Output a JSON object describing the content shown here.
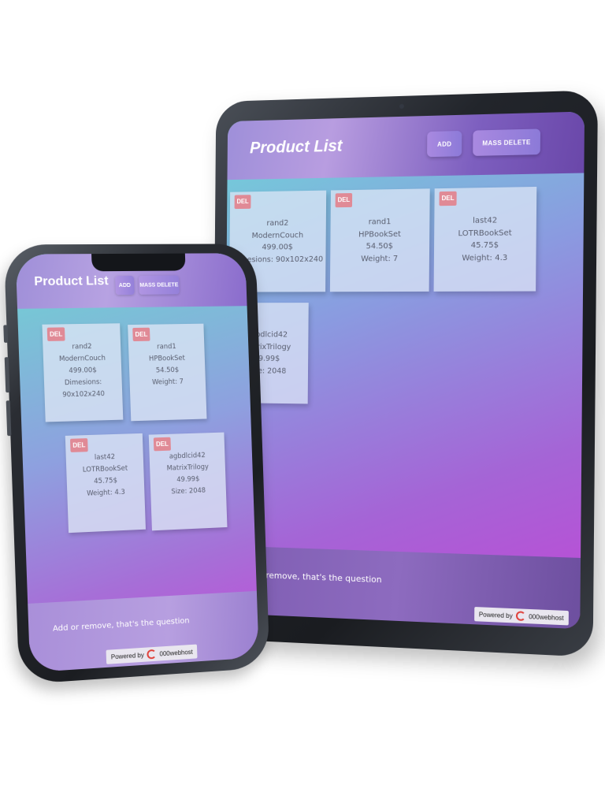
{
  "app": {
    "title": "Product List",
    "add_label": "ADD",
    "mass_delete_label": "MASS DELETE",
    "delete_label": "DEL",
    "footer_text": "Add or remove, that's the question",
    "powered_by": "Powered by",
    "host_name": "000webhost",
    "colors": {
      "delete_badge": "#e08a96",
      "header": "#9e8fd9",
      "gradient_start": "#6fd6d8",
      "gradient_end": "#c048d6"
    }
  },
  "tablet": {
    "footer_text_visible": "dd or remove, that's the question",
    "products": [
      {
        "sku": "rand2",
        "name": "ModernCouch",
        "price": "499.00$",
        "attr": "Dimesions: 90x102x240"
      },
      {
        "sku": "rand1",
        "name": "HPBookSet",
        "price": "54.50$",
        "attr": "Weight: 7"
      },
      {
        "sku": "last42",
        "name": "LOTRBookSet",
        "price": "45.75$",
        "attr": "Weight: 4.3"
      },
      {
        "sku": "agbdlcid42",
        "name": "MatrixTrilogy",
        "price": "49.99$",
        "attr": "Size: 2048"
      }
    ]
  },
  "phone": {
    "products": [
      {
        "sku": "rand2",
        "name": "ModernCouch",
        "price": "499.00$",
        "attr": "Dimesions:",
        "attr2": "90x102x240"
      },
      {
        "sku": "rand1",
        "name": "HPBookSet",
        "price": "54.50$",
        "attr": "Weight: 7"
      },
      {
        "sku": "last42",
        "name": "LOTRBookSet",
        "price": "45.75$",
        "attr": "Weight: 4.3"
      },
      {
        "sku": "agbdlcid42",
        "name": "MatrixTrilogy",
        "price": "49.99$",
        "attr": "Size: 2048"
      }
    ]
  }
}
